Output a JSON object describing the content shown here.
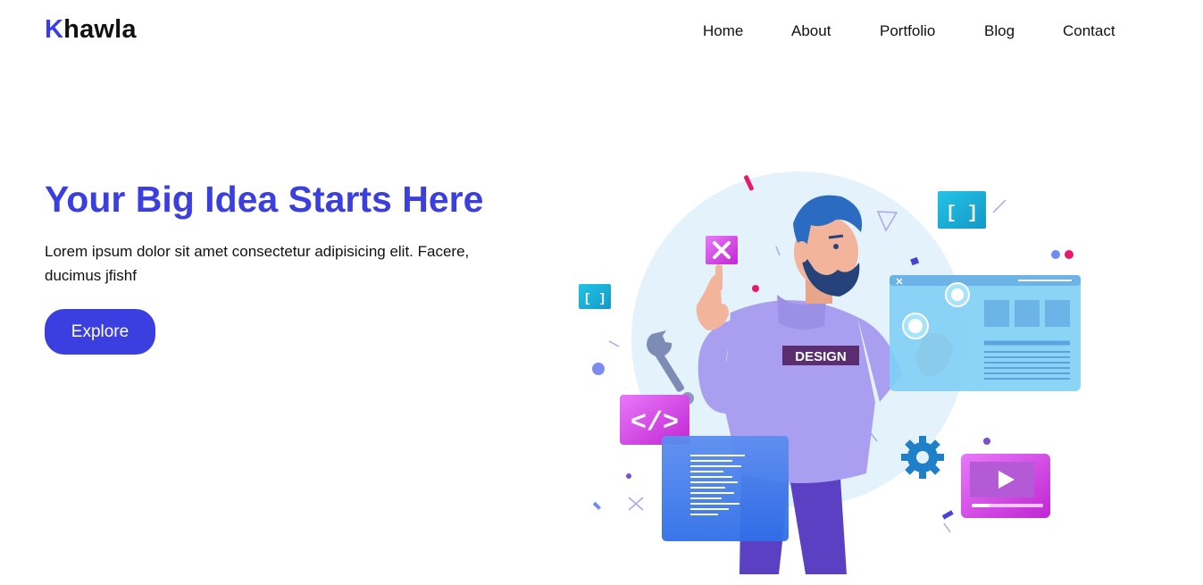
{
  "brand": {
    "initial": "K",
    "rest": "hawla"
  },
  "nav": {
    "items": [
      "Home",
      "About",
      "Portfolio",
      "Blog",
      "Contact"
    ]
  },
  "hero": {
    "title": "Your Big Idea Starts Here",
    "text": "Lorem ipsum dolor sit amet consectetur adipisicing elit. Facere, ducimus jfishf",
    "button_label": "Explore"
  },
  "illustration": {
    "shirt_text": "DESIGN",
    "code_tag": "</>",
    "bracket_tag": "[ ]"
  },
  "colors": {
    "accent": "#3b3fe0",
    "text": "#111111",
    "background": "#ffffff"
  }
}
